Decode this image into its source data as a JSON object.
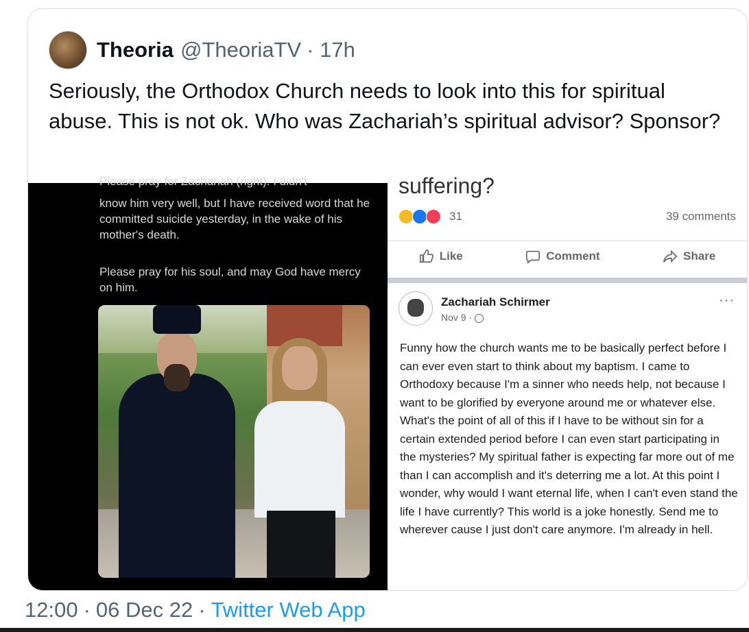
{
  "tweet": {
    "author_name": "Theoria",
    "author_handle": "@TheoriaTV",
    "time_ago": "· 17h",
    "text": "Seriously, the Orthodox Church needs to look into this for spiritual abuse. This is not ok. Who was Zachariah’s spiritual advisor? Sponsor?",
    "footer": {
      "time": "12:00",
      "sep1": "·",
      "date": "06 Dec 22",
      "sep2": "·",
      "app": "Twitter Web App"
    }
  },
  "left_post": {
    "cut_text": "Please pray for Zachariah (right). I didn't",
    "text1": "know him very well, but I have received word that he committed suicide yesterday, in the wake of his mother's death.",
    "text2": "Please pray for his soul, and may God have mercy on him."
  },
  "right_post": {
    "cut_text": "suffering?",
    "reaction_count": "31",
    "comments": "39 comments",
    "actions": {
      "like": "Like",
      "comment": "Comment",
      "share": "Share"
    },
    "author": "Zachariah Schirmer",
    "date": "Nov 9 · ",
    "more": "···",
    "body": "Funny how the church wants me to be basically perfect before I can ever even start to think about my baptism. I came to Orthodoxy because I'm a sinner who needs help, not because I want to be glorified by everyone around me or whatever else. What's the point of all of this if I have to be without sin for a certain extended period before I can even start participating in the mysteries? My spiritual father is expecting far more out of me than I can accomplish and it's deterring me a lot. At this point I wonder, why would I want eternal life, when I can't even stand the life I have currently? This world is a joke honestly. Send me to wherever cause I just don't care anymore. I'm already in hell."
  }
}
